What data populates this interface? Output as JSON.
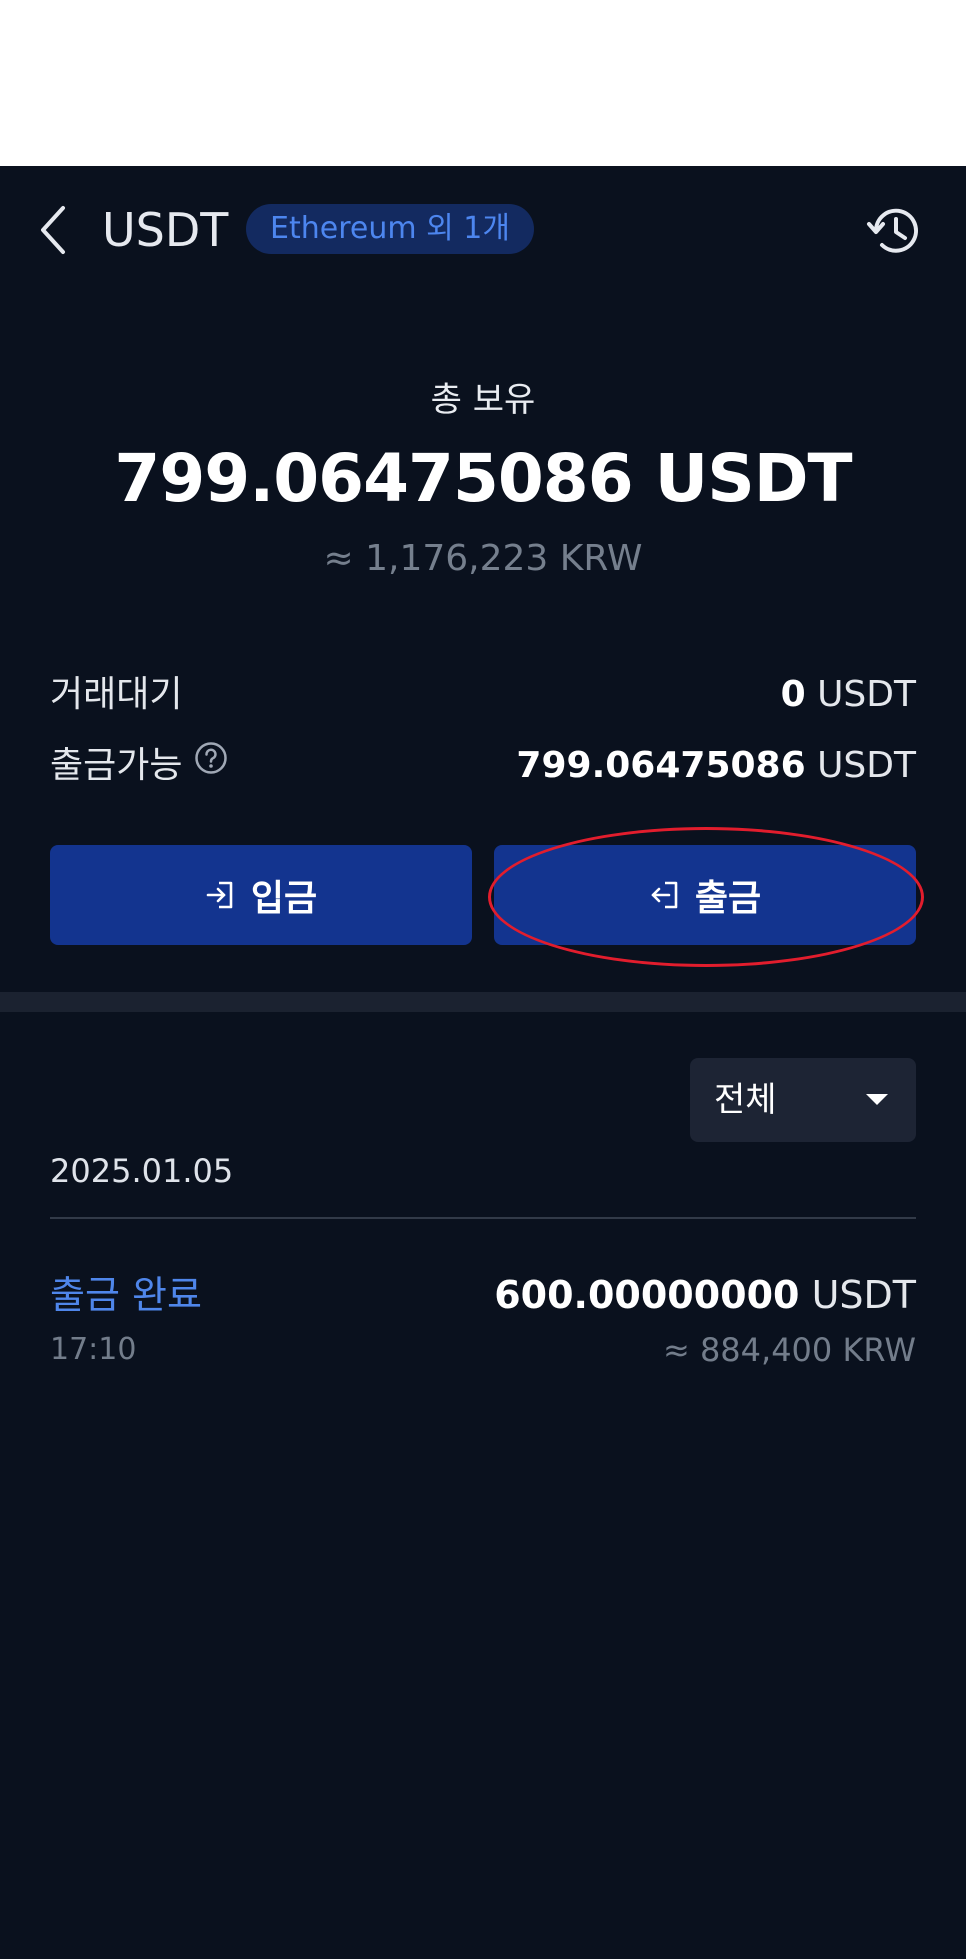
{
  "header": {
    "title": "USDT",
    "network_badge": "Ethereum 외 1개"
  },
  "summary": {
    "total_label": "총 보유",
    "total_amount": "799.06475086 USDT",
    "total_krw": "≈ 1,176,223 KRW",
    "pending_label": "거래대기",
    "pending_value": "0",
    "pending_unit": " USDT",
    "available_label": "출금가능",
    "available_value": "799.06475086",
    "available_unit": " USDT"
  },
  "actions": {
    "deposit_label": "입금",
    "withdraw_label": "출금"
  },
  "filter": {
    "selected": "전체"
  },
  "history": {
    "date": "2025.01.05",
    "transactions": [
      {
        "status": "출금 완료",
        "time": "17:10",
        "amount": "600.00000000",
        "unit": " USDT",
        "krw": "≈ 884,400 KRW"
      }
    ]
  },
  "colors": {
    "background": "#0a111e",
    "accent_blue": "#13348f",
    "status_blue": "#4f86ea",
    "highlight_red": "#e21d2d"
  },
  "icons": {
    "back": "chevron-left-icon",
    "history": "history-clock-icon",
    "help": "question-circle-icon",
    "deposit": "login-arrow-icon",
    "withdraw": "logout-arrow-icon",
    "filter": "caret-down-icon"
  }
}
